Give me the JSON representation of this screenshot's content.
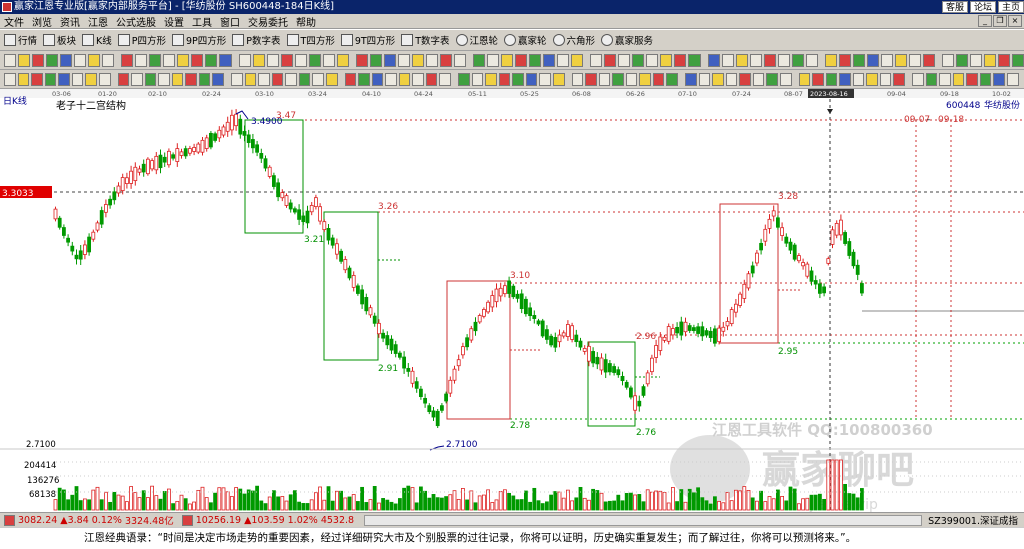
{
  "window": {
    "title": "赢家江恩专业版[赢家内部服务平台] - [华纺股份 SH600448-184日K线]",
    "top_buttons": [
      "客服",
      "论坛",
      "主页"
    ]
  },
  "menu": [
    "文件",
    "浏览",
    "资讯",
    "江恩",
    "公式选股",
    "设置",
    "工具",
    "窗口",
    "交易委托",
    "帮助"
  ],
  "toolbar1": [
    "行情",
    "板块",
    "K线",
    "P四方形",
    "9P四方形",
    "P数字表",
    "T四方形",
    "9T四方形",
    "T数字表",
    "江恩轮",
    "赢家轮",
    "六角形",
    "赢家服务"
  ],
  "chart": {
    "period_label": "日K线",
    "pattern_label": "老子十二宫结构",
    "stock_code": "600448",
    "stock_name": "华纺股份",
    "date_axis": [
      "03-06",
      "01-20",
      "02-10",
      "02-24",
      "03-10",
      "03-24",
      "04-10",
      "04-24",
      "05-11",
      "05-25",
      "06-08",
      "06-26",
      "07-10",
      "07-24",
      "08-07",
      "2023-08-16",
      "09-04",
      "09-18",
      "10-02"
    ],
    "cursor_date": "2023-08-16",
    "right_dates": [
      "09-07",
      "09-18"
    ],
    "price_flag": "3.3033",
    "labels": {
      "hi1": "3.4900",
      "p347": "3.47",
      "p326": "3.26",
      "p321": "3.21",
      "p310": "3.10",
      "p291": "2.91",
      "p278": "2.78",
      "p276": "2.76",
      "p296": "2.96",
      "p328": "3.28",
      "p295": "2.95",
      "lo1": "2.7100",
      "axis271": "2.7100"
    },
    "watermark1": "江恩工具软件  QQ:100800360",
    "watermark2": "赢家聊吧",
    "watermark3": "jiaoba.vip",
    "volume_axis": [
      "204414",
      "136276",
      "68138"
    ]
  },
  "status": {
    "idx1_value": "3082.24",
    "idx1_change": "▲3.84",
    "idx1_pct": "0.12%",
    "idx1_amount": "3324.48亿",
    "idx2_value": "10256.19",
    "idx2_change": "▲103.59",
    "idx2_pct": "1.02%",
    "idx2_amount": "4532.8",
    "right_label": "SZ399001.深证成指"
  },
  "quote": "江恩经典语录：“时间是决定市场走势的重要因素，经过详细研究大市及个别股票的过往记录，你将可以证明，历史确实重复发生；而了解过往，你将可以预测将来。”。"
}
